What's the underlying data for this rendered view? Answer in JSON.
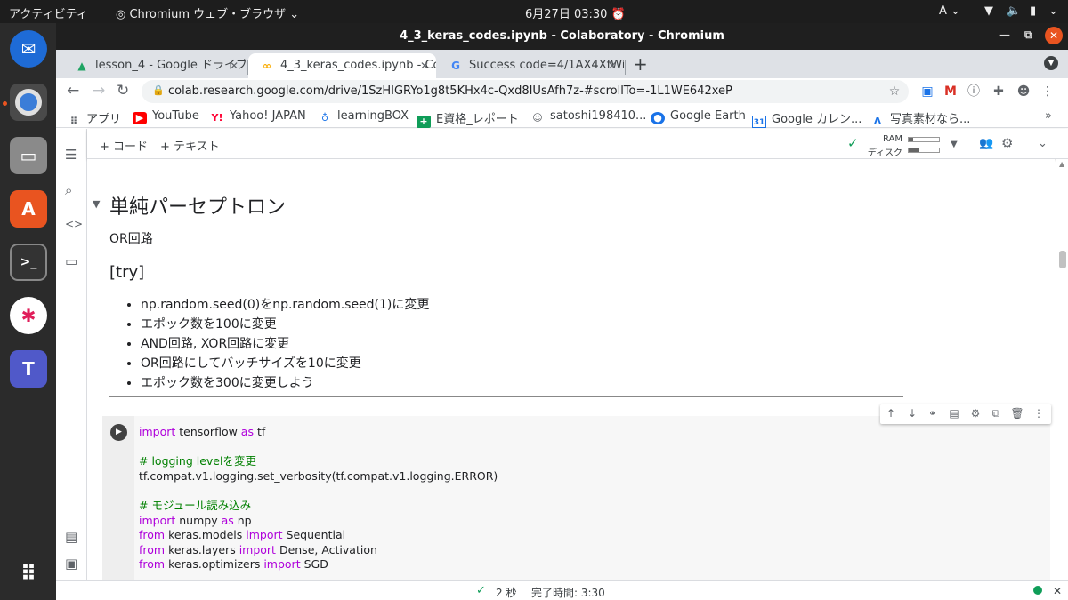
{
  "topbar": {
    "activities": "アクティビティ",
    "app_name": "Chromium ウェブ・ブラウザ",
    "clock": "6月27日  03:30",
    "input_method": "A"
  },
  "window": {
    "title": "4_3_keras_codes.ipynb - Colaboratory - Chromium"
  },
  "tabs": [
    {
      "label": "lesson_4 - Google ドライブ"
    },
    {
      "label": "4_3_keras_codes.ipynb - Colaboratory"
    },
    {
      "label": "Success code=4/1AX4XfWi"
    }
  ],
  "omnibox": {
    "url": "colab.research.google.com/drive/1SzHIGRYo1g8t5KHx4c-Qxd8IUsAfh7z-#scrollTo=-1L1WE642xeP"
  },
  "bookmarks": [
    {
      "label": "アプリ"
    },
    {
      "label": "YouTube"
    },
    {
      "label": "Yahoo! JAPAN"
    },
    {
      "label": "learningBOX"
    },
    {
      "label": "E資格_レポート"
    },
    {
      "label": "satoshi198410..."
    },
    {
      "label": "Google Earth"
    },
    {
      "label": "Google カレン..."
    },
    {
      "label": "写真素材なら..."
    }
  ],
  "colab_toolbar": {
    "add_code": "+ コード",
    "add_text": "+ テキスト",
    "ram_label": "RAM",
    "disk_label": "ディスク",
    "ram_usage": 0.15,
    "disk_usage": 0.35
  },
  "notebook": {
    "section_title": "単純パーセプトロン",
    "subtitle": "OR回路",
    "try_heading": "[try]",
    "bullets": [
      "np.random.seed(0)をnp.random.seed(1)に変更",
      "エポック数を100に変更",
      "AND回路, XOR回路に変更",
      "OR回路にしてバッチサイズを10に変更",
      "エポック数を300に変更しよう"
    ],
    "code": {
      "l1_kw": "import",
      "l1_a": " tensorflow ",
      "l1_kw2": "as",
      "l1_b": " tf",
      "l2_comment": "# logging levelを変更",
      "l3": "tf.compat.v1.logging.set_verbosity(tf.compat.v1.logging.ERROR)",
      "l4_comment": "# モジュール読み込み",
      "l5_kw": "import",
      "l5_a": " numpy ",
      "l5_kw2": "as",
      "l5_b": " np",
      "l6_kw": "from",
      "l6_a": " keras.models ",
      "l6_kw2": "import",
      "l6_b": " Sequential",
      "l7_kw": "from",
      "l7_a": " keras.layers ",
      "l7_kw2": "import",
      "l7_b": " Dense, Activation",
      "l8_kw": "from",
      "l8_a": " keras.optimizers ",
      "l8_kw2": "import",
      "l8_b": " SGD"
    }
  },
  "status": {
    "duration": "2 秒",
    "completed": "完了時間: 3:30"
  },
  "colors": {
    "keyword": "#af00db",
    "comment": "#008000",
    "ok_check": "#0f9d58",
    "ubuntu_orange": "#e95420"
  }
}
